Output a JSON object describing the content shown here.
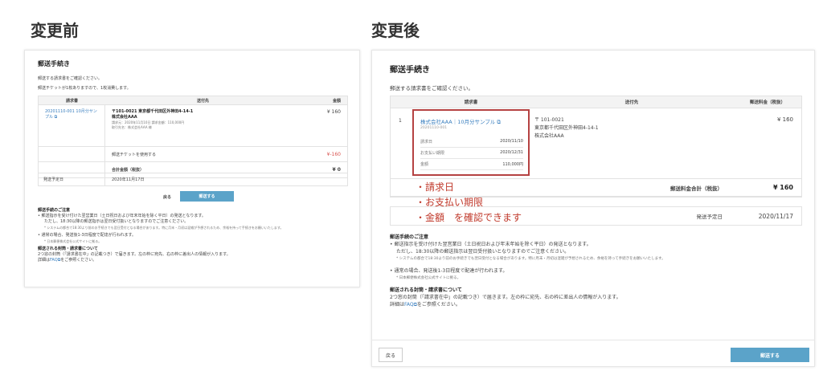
{
  "labels": {
    "before": "変更前",
    "after": "変更後"
  },
  "before": {
    "title": "郵送手続き",
    "desc1": "郵送する請求書をご確認ください。",
    "desc2": "郵送チケットが1枚ありますので、1枚消費します。",
    "headers": [
      "請求書",
      "送付先",
      "金額"
    ],
    "invoice_link": "20201110-001 10月分サンプル ⧉",
    "address_line": "〒101-0021 東京都千代田区外神田4-14-1",
    "company": "株式会社AAA",
    "sub1": "請求元：2020年11月10日 請求金額：110,000円",
    "sub2": "取引先名：株式会社AAA 様",
    "amount": "¥ 160",
    "ticket_label": "郵送チケットを使用する",
    "ticket_value": "¥-160",
    "total_label": "合計金額（税抜）",
    "total_value": "¥ 0",
    "ship_label": "発送予定日",
    "ship_value": "2020年11月17日",
    "back_label": "戻る",
    "send_label": "郵送する",
    "notes": {
      "heading1": "郵送手続のご注意",
      "n1": "• 郵送指示を受け付けた翌営業日（土日祝日および年末年始を除く平日）の発送となります。",
      "n1b": "ただし、18:30以降の郵送指示は翌日受付扱いとなりますのでご注意ください。",
      "n1c": "* システムの都合で18:30より前のお手続きでも翌日受付となる場合があります。特に月末・月初は混雑が予想されるため、余裕を持って手続きをお願いいたします。",
      "n2": "• 通常の場合、発送後1-3日程度で配達が行われます。",
      "n2b": "* 日本郵便株式会社公式サイトに拠る。",
      "heading2": "郵送される封筒・請求書について",
      "n3": "2つ窓の封筒（「請求書在中」の記載つき）で届きます。左の枠に宛先、右の枠に差出人の情報が入ります。",
      "n4_prefix": "詳細は",
      "n4_link": "FAQ⧉",
      "n4_suffix": "をご参照ください。"
    }
  },
  "after": {
    "title": "郵送手続き",
    "desc": "郵送する請求書をご確認ください。",
    "headers": [
      "請求書",
      "送付先",
      "郵送料金（税抜）"
    ],
    "row_num": "1",
    "invoice_link": "株式会社AAA｜10月分サンプル ⧉",
    "invoice_num": "20201110-001",
    "kv": [
      {
        "k": "請求日",
        "v": "2020/11/10"
      },
      {
        "k": "お支払い期限",
        "v": "2020/12/31"
      },
      {
        "k": "金額",
        "v": "110,000円"
      }
    ],
    "postal": "〒 101-0021",
    "address": "東京都千代田区外神田4-14-1",
    "company": "株式会社AAA",
    "amount": "¥ 160",
    "total_label": "郵送料金合計（税抜）",
    "total_value": "¥ 160",
    "ship_label": "発送予定日",
    "ship_value": "2020/11/17",
    "annotations": [
      "・請求日",
      "・お支払い期限",
      "・金額　を確認できます"
    ],
    "notes": {
      "heading1": "郵送手続のご注意",
      "n1": "• 郵送指示を受け付けた翌営業日（土日祝日および年末年始を除く平日）の発送となります。",
      "n1b": "ただし、18:30以降の郵送指示は翌日受付扱いとなりますのでご注意ください。",
      "n1c": "* システムの都合で18:30より前のお手続きでも翌日受付となる場合があります。特に月末・月初は混雑が予想されるため、余裕を持って手続きをお願いいたします。",
      "n2": "• 通常の場合、発送後1-3日程度で配達が行われます。",
      "n2b": "* 日本郵便株式会社公式サイトに拠る。",
      "heading2": "郵送される封筒・請求書について",
      "n3": "2つ窓の封筒（「請求書在中」の記載つき）で届きます。左の枠に宛先、右の枠に差出人の情報が入ります。",
      "n4_prefix": "詳細は",
      "n4_link": "FAQ⧉",
      "n4_suffix": "をご参照ください。"
    },
    "back_label": "戻る",
    "send_label": "郵送する"
  },
  "colors": {
    "accent": "#5ba3c9",
    "link": "#3a7fbf",
    "highlight": "#b54242",
    "annotation": "#c0392b"
  }
}
